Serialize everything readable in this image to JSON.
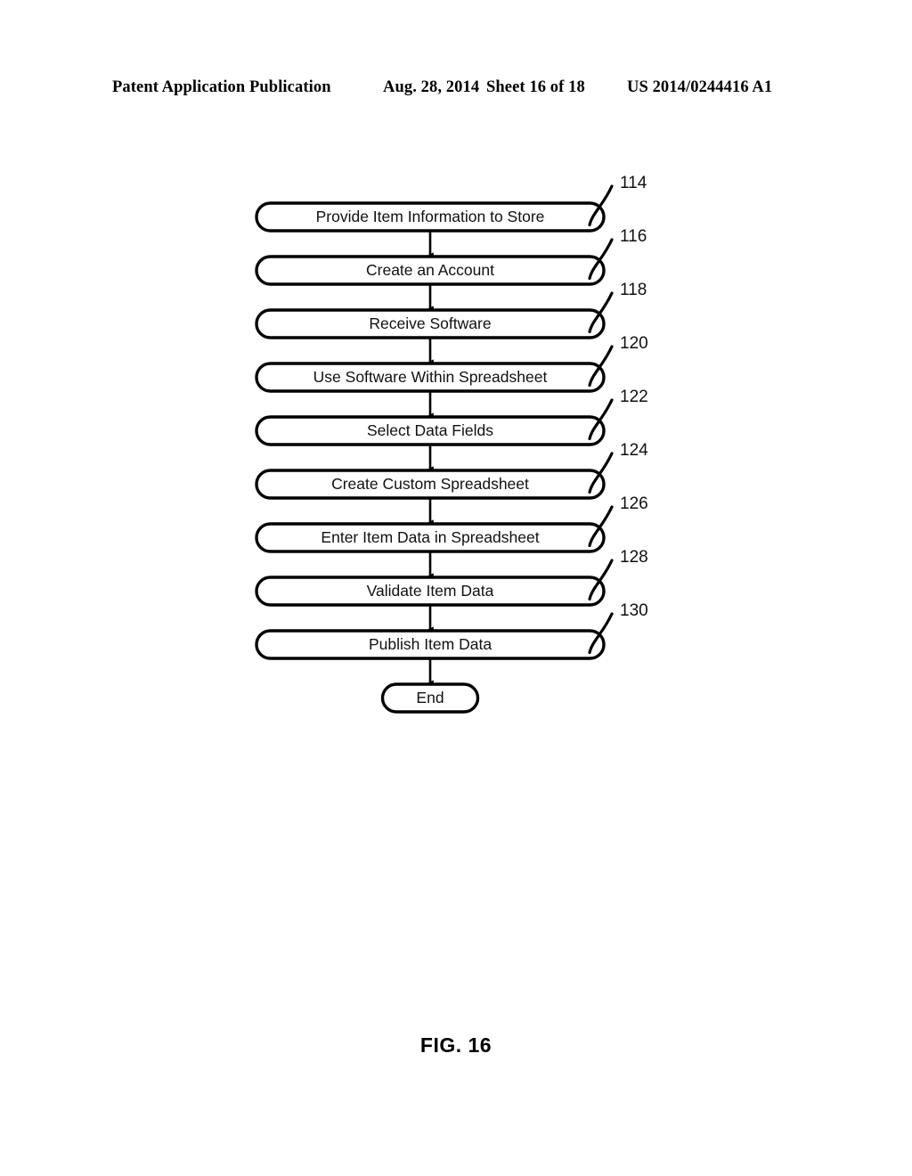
{
  "header": {
    "publication": "Patent Application Publication",
    "date": "Aug. 28, 2014",
    "sheet": "Sheet 16 of 18",
    "patent_number": "US 2014/0244416 A1"
  },
  "figure": {
    "caption": "FIG. 16",
    "stroke_color": "#000000",
    "background_color": "#ffffff",
    "nodes": [
      {
        "label": "Provide Item Information to Store",
        "ref": "114"
      },
      {
        "label": "Create an Account",
        "ref": "116"
      },
      {
        "label": "Receive Software",
        "ref": "118"
      },
      {
        "label": "Use Software Within Spreadsheet",
        "ref": "120"
      },
      {
        "label": "Select Data Fields",
        "ref": "122"
      },
      {
        "label": "Create Custom Spreadsheet",
        "ref": "124"
      },
      {
        "label": "Enter Item Data in Spreadsheet",
        "ref": "126"
      },
      {
        "label": "Validate Item Data",
        "ref": "128"
      },
      {
        "label": "Publish Item Data",
        "ref": "130"
      }
    ],
    "terminator": {
      "label": "End"
    }
  }
}
